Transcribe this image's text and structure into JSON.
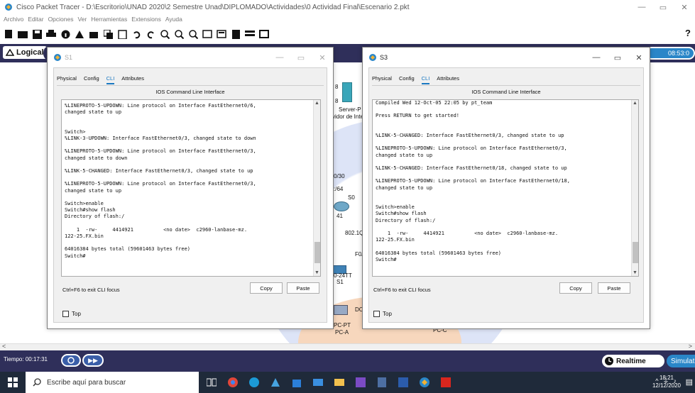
{
  "main_window": {
    "title": "Cisco Packet Tracer - D:\\Escritorio\\UNAD 2020\\2 Semestre Unad\\DIPLOMADO\\Actividades\\0 Actividad Final\\Escenario 2.pkt",
    "minimize": "—",
    "maximize": "▭",
    "close": "✕"
  },
  "menu": [
    "Archivo",
    "Editar",
    "Opciones",
    "Ver",
    "Herramientas",
    "Extensions",
    "Ayuda"
  ],
  "toolbar": {
    "help": "?"
  },
  "logical_bar": {
    "logical_label": "Logical",
    "time": "08:53:0"
  },
  "workspace_labels": {
    "server_label": "Server-P",
    "server_sublabel": "vidor de Inte",
    "ip1": "0/30",
    "ip2": ":/64",
    "s0": "S0",
    "l41": "41",
    "q802": "802.1Q",
    "f0": "F0/",
    "f024tt": "0-24TT",
    "s1": "S1",
    "dc": "DC",
    "pc_pt": "PC-PT",
    "pc_a": "PC-A",
    "pc_c": "PC-C",
    "n8a": "8",
    "n8b": "8"
  },
  "s1_window": {
    "title": "S1",
    "tabs": [
      "Physical",
      "Config",
      "CLI",
      "Attributes"
    ],
    "active_tab": "CLI",
    "heading": "IOS Command Line Interface",
    "console_text": "%LINEPROTO-5-UPDOWN: Line protocol on Interface FastEthernet0/6,\nchanged state to up\n\n\nSwitch>\n%LINK-3-UPDOWN: Interface FastEthernet0/3, changed state to down\n\n%LINEPROTO-5-UPDOWN: Line protocol on Interface FastEthernet0/3,\nchanged state to down\n\n%LINK-5-CHANGED: Interface FastEthernet0/3, changed state to up\n\n%LINEPROTO-5-UPDOWN: Line protocol on Interface FastEthernet0/3,\nchanged state to up\n\nSwitch>enable\nSwitch#show flash\nDirectory of flash:/\n\n    1  -rw-     4414921          <no date>  c2960-lanbase-mz.\n122-25.FX.bin\n\n64016384 bytes total (59601463 bytes free)\nSwitch#",
    "hint": "Ctrl+F6 to exit CLI focus",
    "copy": "Copy",
    "paste": "Paste",
    "top": "Top"
  },
  "s3_window": {
    "title": "S3",
    "tabs": [
      "Physical",
      "Config",
      "CLI",
      "Attributes"
    ],
    "active_tab": "CLI",
    "heading": "IOS Command Line Interface",
    "console_text": "Compiled Wed 12-Oct-05 22:05 by pt_team\n\nPress RETURN to get started!\n\n\n%LINK-5-CHANGED: Interface FastEthernet0/3, changed state to up\n\n%LINEPROTO-5-UPDOWN: Line protocol on Interface FastEthernet0/3,\nchanged state to up\n\n%LINK-5-CHANGED: Interface FastEthernet0/18, changed state to up\n\n%LINEPROTO-5-UPDOWN: Line protocol on Interface FastEthernet0/18,\nchanged state to up\n\n\nSwitch>enable\nSwitch#show flash\nDirectory of flash:/\n\n    1  -rw-     4414921          <no date>  c2960-lanbase-mz.\n122-25.FX.bin\n\n64016384 bytes total (59601463 bytes free)\nSwitch#",
    "hint": "Ctrl+F6 to exit CLI focus",
    "copy": "Copy",
    "paste": "Paste",
    "top": "Top"
  },
  "bottom_bar": {
    "time_label": "Tiempo: 00:17:31",
    "realtime": "Realtime",
    "simulation": "Simulatio"
  },
  "taskbar": {
    "search_placeholder": "Escribe aquí para buscar",
    "time": "18:21",
    "date": "12/12/2020"
  },
  "colors": {
    "accent": "#1a78c2",
    "dark_bar": "#2f2f5a",
    "taskbar": "#1f2a3a"
  }
}
